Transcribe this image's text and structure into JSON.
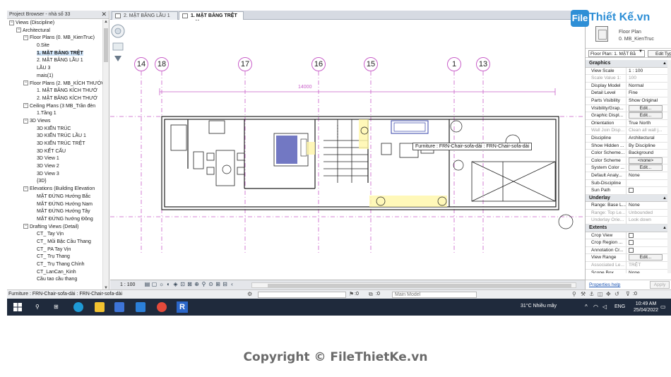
{
  "project_browser": {
    "title": "Project Browser - nhà số 33",
    "close": "✕",
    "tree": [
      {
        "indent": 0,
        "toggle": "−",
        "label": "Views (Discipline)"
      },
      {
        "indent": 1,
        "toggle": "−",
        "label": "Architectural"
      },
      {
        "indent": 2,
        "toggle": "−",
        "label": "Floor Plans (0. MB_KienTruc)"
      },
      {
        "indent": 3,
        "toggle": "",
        "label": "0.Site"
      },
      {
        "indent": 3,
        "toggle": "",
        "label": "1. MẶT BẰNG TRỆT",
        "bold": true,
        "selected": true
      },
      {
        "indent": 3,
        "toggle": "",
        "label": "2. MẶT BẰNG LẦU 1"
      },
      {
        "indent": 3,
        "toggle": "",
        "label": "LẦU 3"
      },
      {
        "indent": 3,
        "toggle": "",
        "label": "mais(1)"
      },
      {
        "indent": 2,
        "toggle": "−",
        "label": "Floor Plans (2. MB_KÍCH THƯỚC"
      },
      {
        "indent": 3,
        "toggle": "",
        "label": "1. MẶT BẰNG KÍCH THƯỚ"
      },
      {
        "indent": 3,
        "toggle": "",
        "label": "2. MẶT BẰNG KÍCH THƯỚ"
      },
      {
        "indent": 2,
        "toggle": "−",
        "label": "Ceiling Plans (3 MB_Trần đèn"
      },
      {
        "indent": 3,
        "toggle": "",
        "label": "1.Tầng 1"
      },
      {
        "indent": 2,
        "toggle": "−",
        "label": "3D Views"
      },
      {
        "indent": 3,
        "toggle": "",
        "label": "3D KIẾN TRÚC"
      },
      {
        "indent": 3,
        "toggle": "",
        "label": "3D KIẾN TRÚC LẦU 1"
      },
      {
        "indent": 3,
        "toggle": "",
        "label": "3D KIẾN TRÚC TRỆT"
      },
      {
        "indent": 3,
        "toggle": "",
        "label": "3D KẾT CẤU"
      },
      {
        "indent": 3,
        "toggle": "",
        "label": "3D View 1"
      },
      {
        "indent": 3,
        "toggle": "",
        "label": "3D View 2"
      },
      {
        "indent": 3,
        "toggle": "",
        "label": "3D View 3"
      },
      {
        "indent": 3,
        "toggle": "",
        "label": "{3D}"
      },
      {
        "indent": 2,
        "toggle": "−",
        "label": "Elevations (Building Elevation"
      },
      {
        "indent": 3,
        "toggle": "",
        "label": "MẶT ĐỨNG Hướng Bắc"
      },
      {
        "indent": 3,
        "toggle": "",
        "label": "MẶT ĐỨNG Hướng Nam"
      },
      {
        "indent": 3,
        "toggle": "",
        "label": "MẶT ĐỨNG Hướng Tây"
      },
      {
        "indent": 3,
        "toggle": "",
        "label": "MẶT ĐỨNG hướng Đông"
      },
      {
        "indent": 2,
        "toggle": "−",
        "label": "Drafting Views (Detail)"
      },
      {
        "indent": 3,
        "toggle": "",
        "label": "CT_ Tay Vịn"
      },
      {
        "indent": 3,
        "toggle": "",
        "label": "CT_ Mũi Bậc Cầu Thang"
      },
      {
        "indent": 3,
        "toggle": "",
        "label": "CT_ PA Tay Vịn"
      },
      {
        "indent": 3,
        "toggle": "",
        "label": "CT_ Trụ Thang"
      },
      {
        "indent": 3,
        "toggle": "",
        "label": "CT_ Trụ Thang Chính"
      },
      {
        "indent": 3,
        "toggle": "",
        "label": "CT_LanCan_Kinh"
      },
      {
        "indent": 3,
        "toggle": "",
        "label": "Cầu tao cầu thang"
      }
    ]
  },
  "tabs": [
    {
      "label": "2. MẶT BẰNG LẦU 1",
      "active": false
    },
    {
      "label": "1. MẶT BẰNG TRỆT",
      "active": true
    }
  ],
  "tab_close": "✕",
  "canvas": {
    "grid_labels": [
      "14",
      "18",
      "17",
      "16",
      "15",
      "1",
      "13"
    ],
    "dimension": "14000",
    "tooltip": "Furniture : FRN-Chair-sofa-dài : FRN-Chair-sofa-dài"
  },
  "view_bar": {
    "scale": "1 : 100"
  },
  "properties": {
    "type_name_line1": "Floor Plan",
    "type_name_line2": "0. MB_KienTruc",
    "filter": "Floor Plan: 1. MẶT Bằ",
    "edit_type": "Edit Type",
    "groups": [
      {
        "title": "Graphics",
        "rows": [
          {
            "k": "View Scale",
            "v": "1 : 100",
            "kind": "field"
          },
          {
            "k": "Scale Value    1:",
            "v": "100",
            "dim": true
          },
          {
            "k": "Display Model",
            "v": "Normal"
          },
          {
            "k": "Detail Level",
            "v": "Fine"
          },
          {
            "k": "Parts Visibility",
            "v": "Show Original"
          },
          {
            "k": "Visibility/Grap...",
            "v": "Edit...",
            "kind": "btn"
          },
          {
            "k": "Graphic Displ...",
            "v": "Edit...",
            "kind": "btn"
          },
          {
            "k": "Orientation",
            "v": "True North"
          },
          {
            "k": "Wall Join Disp...",
            "v": "Clean all wall j...",
            "dim": true
          },
          {
            "k": "Discipline",
            "v": "Architectural"
          },
          {
            "k": "Show Hidden ...",
            "v": "By Discipline"
          },
          {
            "k": "Color Scheme...",
            "v": "Background"
          },
          {
            "k": "Color Scheme",
            "v": "<none>",
            "kind": "btn"
          },
          {
            "k": "System Color ...",
            "v": "Edit...",
            "kind": "btn"
          },
          {
            "k": "Default Analy...",
            "v": "None"
          },
          {
            "k": "Sub-Discipline",
            "v": ""
          },
          {
            "k": "Sun Path",
            "v": "",
            "kind": "cb"
          }
        ]
      },
      {
        "title": "Underlay",
        "rows": [
          {
            "k": "Range: Base L...",
            "v": "None"
          },
          {
            "k": "Range: Top Le...",
            "v": "Unbounded",
            "dim": true
          },
          {
            "k": "Underlay Orie...",
            "v": "Look down",
            "dim": true
          }
        ]
      },
      {
        "title": "Extents",
        "rows": [
          {
            "k": "Crop View",
            "v": "",
            "kind": "cb"
          },
          {
            "k": "Crop Region ...",
            "v": "",
            "kind": "cb"
          },
          {
            "k": "Annotation Cr...",
            "v": "",
            "kind": "cb"
          },
          {
            "k": "View Range",
            "v": "Edit...",
            "kind": "btn"
          },
          {
            "k": "Associated Le...",
            "v": "TRỆT",
            "dim": true
          },
          {
            "k": "Scope Box",
            "v": "None"
          }
        ]
      }
    ],
    "help_link": "Properties help",
    "apply": "Apply"
  },
  "status_bar": {
    "text": "Furniture : FRN-Chair-sofa-dài : FRN-Chair-sofa-dài",
    "zero1": ":0",
    "zero2": ":0",
    "model": "Main Model",
    "zero3": ":0"
  },
  "taskbar": {
    "weather": "31°C  Nhiều mây",
    "lang": "ENG",
    "time": "10:49 AM",
    "date": "25/04/2022",
    "app_letter": "R"
  },
  "watermark": {
    "logo_mark": "File",
    "logo_text": "Thiết Kế.vn",
    "copyright": "Copyright © FileThietKe.vn"
  },
  "colors": {
    "grid_line": "#c95fc9",
    "taskbar": "#1f2a3c",
    "selection": "#cfe3f7",
    "brand_blue": "#2e8fd6"
  }
}
